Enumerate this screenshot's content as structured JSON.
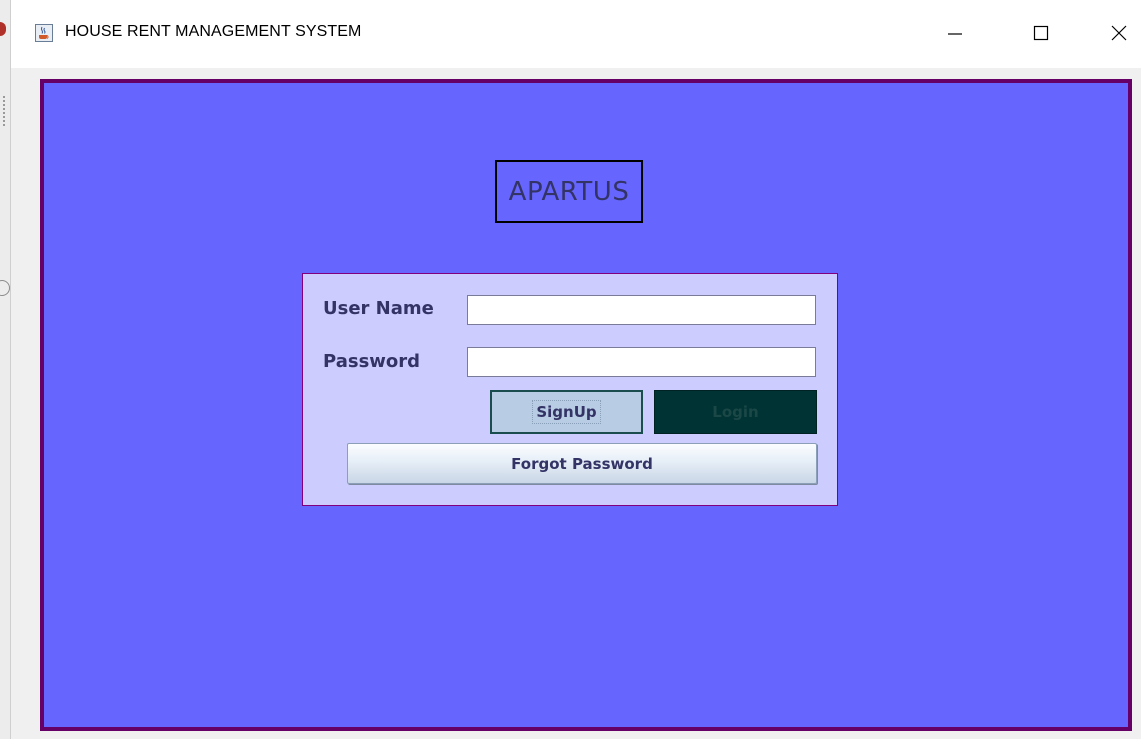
{
  "window": {
    "title": "HOUSE RENT MANAGEMENT SYSTEM",
    "icon": "java-cup-icon",
    "controls": [
      "minimize-icon",
      "maximize-icon",
      "close-icon"
    ]
  },
  "app": {
    "logo_text": "APARTUS"
  },
  "login_form": {
    "username_label": "User Name",
    "username_value": "",
    "password_label": "Password",
    "password_value": "",
    "signup_label": "SignUp",
    "login_label": "Login",
    "forgot_label": "Forgot Password"
  },
  "colors": {
    "background": "#6666ff",
    "frame_border": "#660066",
    "panel": "#ccccff",
    "panel_border": "#800080",
    "text": "#333366",
    "signup_button": "#b8cce4",
    "login_button": "#003333"
  }
}
